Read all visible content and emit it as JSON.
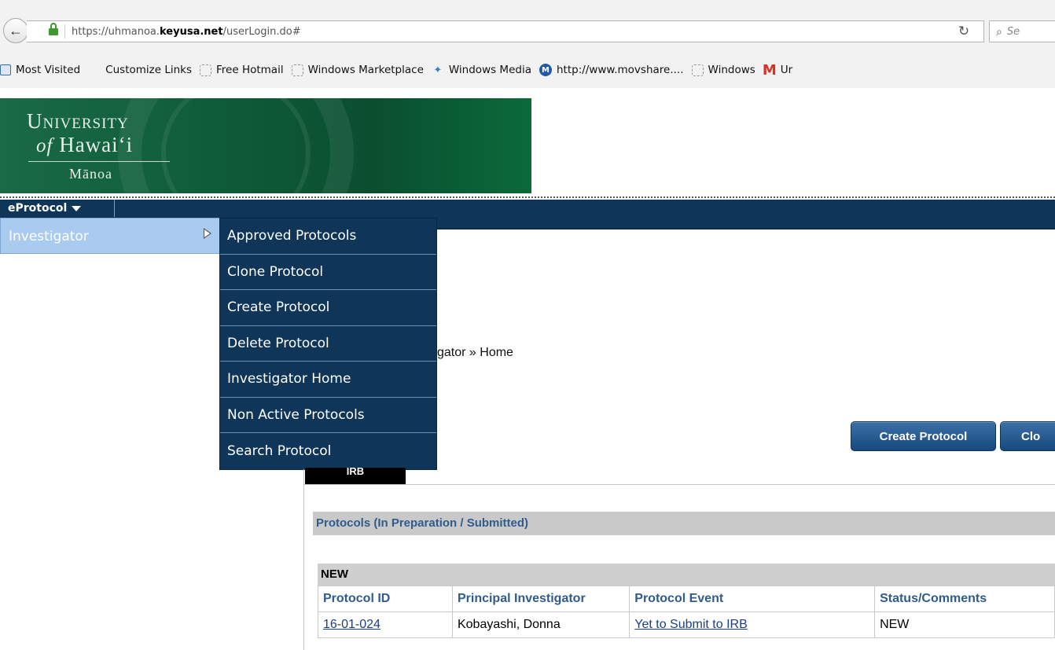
{
  "browser": {
    "url_prefix": "https://uhmanoa.",
    "url_domain": "keyusa.net",
    "url_path": "/userLogin.do#",
    "search_placeholder": "Se",
    "bookmarks": [
      {
        "label": "Most Visited",
        "icon": "bookmark-folder-icon"
      },
      {
        "label": "Customize Links",
        "icon": "windows-logo-icon"
      },
      {
        "label": "Free Hotmail",
        "icon": "blank-page-icon"
      },
      {
        "label": "Windows Marketplace",
        "icon": "blank-page-icon"
      },
      {
        "label": "Windows Media",
        "icon": "windows-media-icon"
      },
      {
        "label": "http://www.movshare....",
        "icon": "movshare-icon"
      },
      {
        "label": "Windows",
        "icon": "blank-page-icon"
      },
      {
        "label": "Ur",
        "icon": "gmail-icon"
      }
    ]
  },
  "banner": {
    "line1": "University",
    "line2_of": "of",
    "line2_name": "Hawaiʻi",
    "line3": "Mānoa"
  },
  "menu": {
    "root_label": "eProtocol",
    "investigator_label": "Investigator",
    "submenu": [
      "Approved Protocols",
      "Clone Protocol",
      "Create Protocol",
      "Delete Protocol",
      "Investigator Home",
      "Non Active Protocols",
      "Search Protocol"
    ]
  },
  "breadcrumb": "gator » Home",
  "buttons": {
    "create": "Create Protocol",
    "clone": "Clo"
  },
  "irb_tab": "IRB",
  "section_title": "Protocols (In Preparation / Submitted)",
  "group_title": "NEW",
  "table": {
    "headers": [
      "Protocol ID",
      "Principal Investigator",
      "Protocol Event",
      "Status/Comments"
    ],
    "rows": [
      {
        "id": "16-01-024",
        "pi": "Kobayashi, Donna",
        "event": "Yet to Submit to IRB",
        "status": "NEW"
      }
    ]
  },
  "colors": {
    "menu_bar": "#0f3559",
    "highlight": "#a9cbf0",
    "banner_green": "#0f5c3a",
    "header_text": "#2f5b8d"
  }
}
